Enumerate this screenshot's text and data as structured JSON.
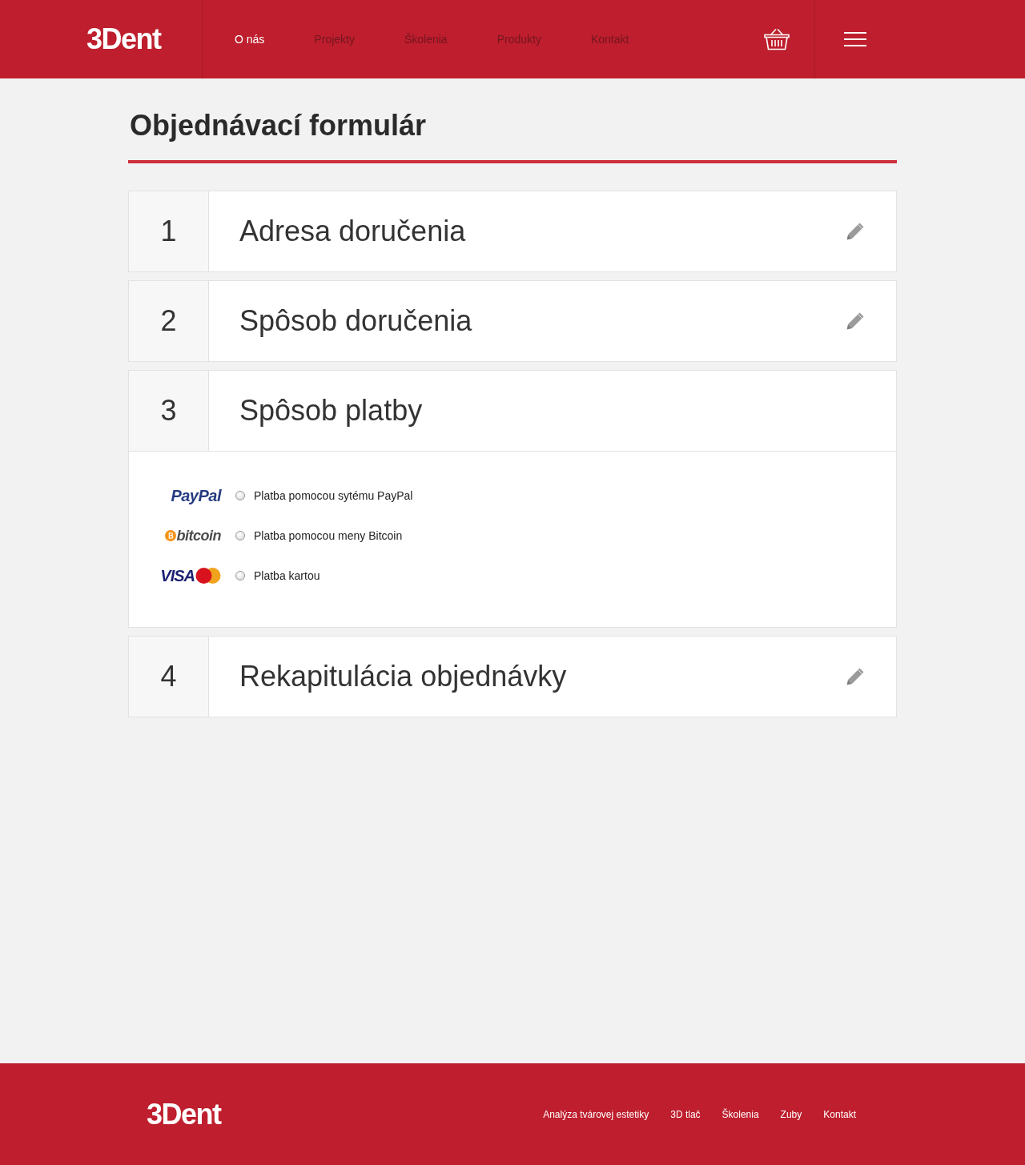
{
  "header": {
    "logo": "3Dent",
    "nav": [
      {
        "label": "O nás",
        "selected": true
      },
      {
        "label": "Projekty",
        "selected": false
      },
      {
        "label": "Školenia",
        "selected": false
      },
      {
        "label": "Produkty",
        "selected": false
      },
      {
        "label": "Kontakt",
        "selected": false
      }
    ]
  },
  "page_title": "Objednávací formulár",
  "steps": [
    {
      "number": "1",
      "title": "Adresa doručenia",
      "expanded": false
    },
    {
      "number": "2",
      "title": "Spôsob doručenia",
      "expanded": false
    },
    {
      "number": "3",
      "title": "Spôsob platby",
      "expanded": true,
      "payment_options": [
        {
          "kind": "wallet",
          "logo": "PayPal",
          "label": "Platba pomocou sytému PayPal",
          "selected": false
        },
        {
          "kind": "coin",
          "logo": "bitcoin",
          "label": "Platba pomocou meny Bitcoin",
          "selected": false
        },
        {
          "kind": "card",
          "logo": "VISA",
          "label": "Platba kartou",
          "selected": false
        }
      ]
    },
    {
      "number": "4",
      "title": "Rekapitulácia objednávky",
      "expanded": false
    }
  ],
  "footer": {
    "logo": "3Dent",
    "links": [
      "Analýza tvárovej estetiky",
      "3D tlač",
      "Školenia",
      "Zuby",
      "Kontakt"
    ]
  }
}
